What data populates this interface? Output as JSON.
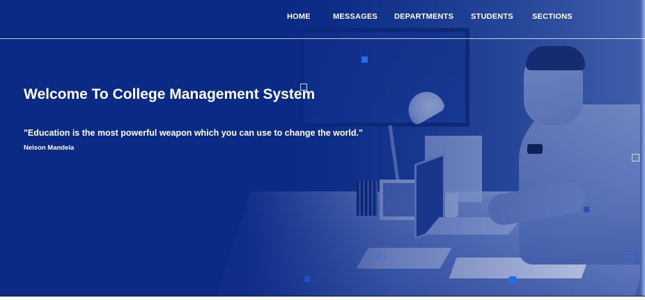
{
  "nav": {
    "items": [
      {
        "label": "HOME"
      },
      {
        "label": "MESSAGES"
      },
      {
        "label": "DEPARTMENTS"
      },
      {
        "label": "STUDENTS"
      },
      {
        "label": "SECTIONS"
      }
    ]
  },
  "hero": {
    "title": "Welcome To College Management System",
    "quote": "\"Education is the most powerful weapon which you can use to change the world.\"",
    "author": "Nelson Mandela"
  },
  "colors": {
    "primary": "#0b2a86",
    "accent": "#1d6ff2",
    "text": "#ffffff"
  }
}
